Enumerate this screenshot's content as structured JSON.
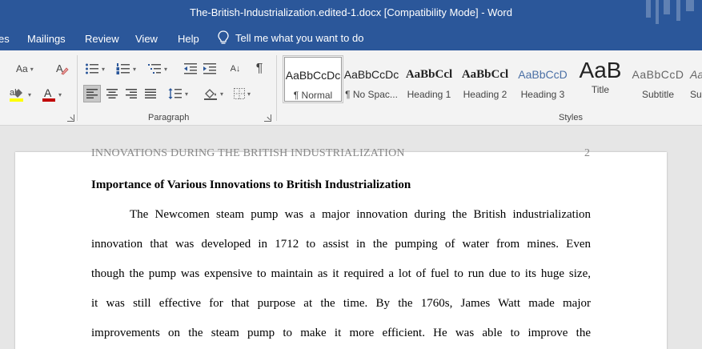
{
  "window": {
    "title": "The-British-Industrialization.edited-1.docx [Compatibility Mode]  -  Word"
  },
  "menu": {
    "tabs": [
      "es",
      "Mailings",
      "Review",
      "View",
      "Help"
    ],
    "tell_me": "Tell me what you want to do"
  },
  "ribbon": {
    "font_group": {
      "size_glyph": "Aa",
      "clear_glyph": "A"
    },
    "paragraph_group": {
      "label": "Paragraph",
      "show_marks_glyph": "¶",
      "sort_glyph": "A↓"
    },
    "styles_group": {
      "label": "Styles",
      "styles": [
        {
          "preview": "AaBbCcDc",
          "label": "¶ Normal",
          "selected": true
        },
        {
          "preview": "AaBbCcDc",
          "label": "¶ No Spac..."
        },
        {
          "preview": "AaBbCcl",
          "label": "Heading 1"
        },
        {
          "preview": "AaBbCcl",
          "label": "Heading 2"
        },
        {
          "preview": "AaBbCcD",
          "label": "Heading 3"
        },
        {
          "preview": "AaB",
          "label": "Title"
        },
        {
          "preview": "AaBbCcD",
          "label": "Subtitle"
        },
        {
          "preview": "AaBbCcD",
          "label": "Su"
        }
      ]
    }
  },
  "colors": {
    "brand": "#2b579a",
    "font_color": "#c00000",
    "highlight": "#ffff00"
  },
  "document": {
    "running_header": "INNOVATIONS DURING THE BRITISH INDUSTRIALIZATION",
    "page_number": "2",
    "heading": "Importance of Various Innovations to British Industrialization",
    "lines": [
      "The Newcomen steam pump was a major innovation during the British industrialization",
      "innovation that was developed in 1712 to assist in the pumping of water from mines. Even",
      "though the pump was expensive to maintain as it required a lot of fuel to run due to its huge size,",
      "it was still effective for that purpose at the time. By the 1760s, James Watt made major",
      "improvements on the steam pump to make it more efficient.  He was able to improve the"
    ]
  }
}
